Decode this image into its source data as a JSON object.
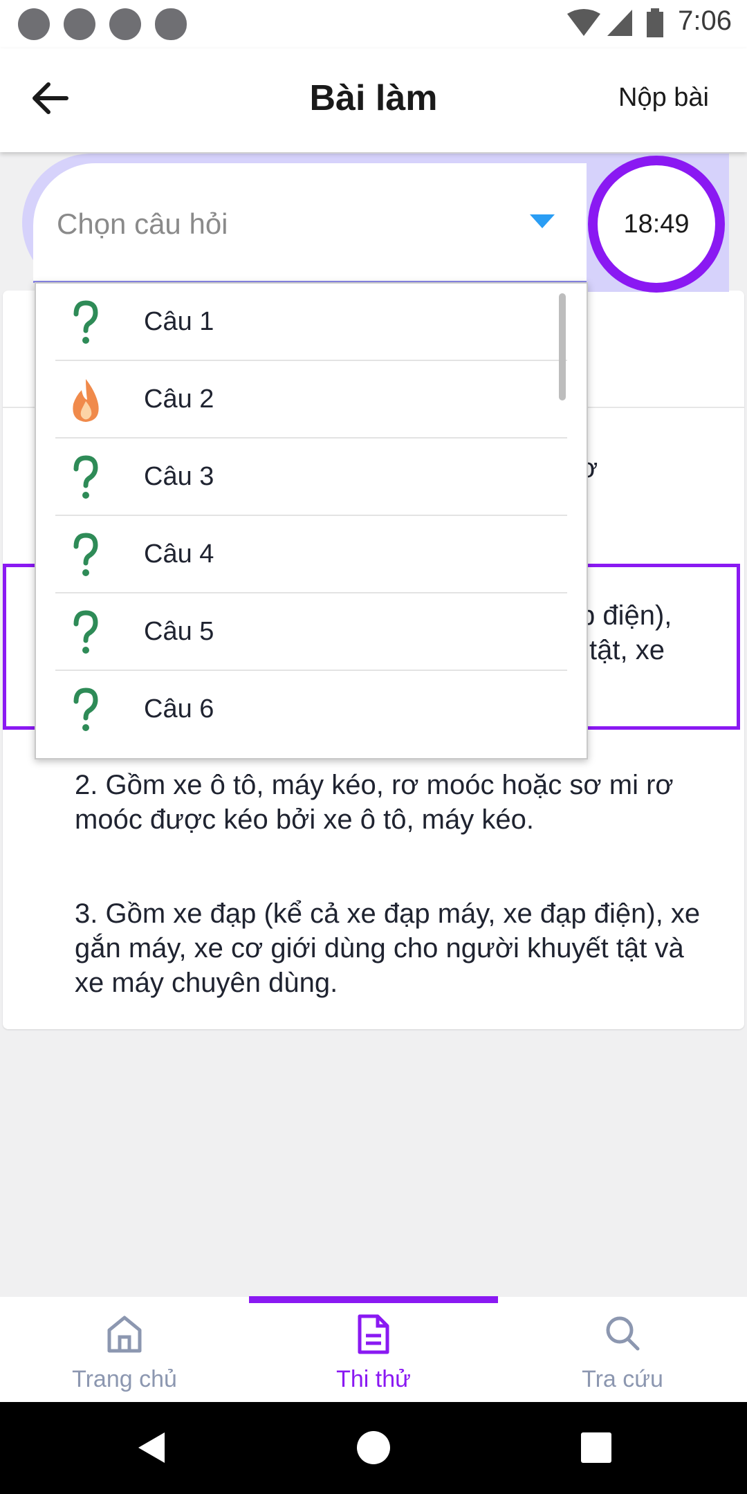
{
  "status_bar": {
    "time": "7:06"
  },
  "app_bar": {
    "title": "Bài làm",
    "submit_label": "Nộp bài"
  },
  "selector": {
    "placeholder": "Chọn câu hỏi",
    "timer": "18:49"
  },
  "dropdown": {
    "items": [
      {
        "label": "Câu 1",
        "icon": "question-icon"
      },
      {
        "label": "Câu 2",
        "icon": "fire-icon"
      },
      {
        "label": "Câu 3",
        "icon": "question-icon"
      },
      {
        "label": "Câu 4",
        "icon": "question-icon"
      },
      {
        "label": "Câu 5",
        "icon": "question-icon"
      },
      {
        "label": "Câu 6",
        "icon": "question-icon"
      }
    ]
  },
  "question": {
    "visible_fragments": [
      "ơ",
      "p điện),",
      "tật, xe"
    ],
    "answers": [
      "2. Gồm xe ô tô, máy kéo, rơ moóc hoặc sơ mi rơ moóc được kéo bởi xe ô tô, máy kéo.",
      "3. Gồm xe đạp (kể cả xe đạp máy, xe đạp điện), xe gắn máy, xe cơ giới dùng cho người khuyết tật và xe máy chuyên dùng."
    ]
  },
  "bottom_nav": {
    "items": [
      {
        "label": "Trang chủ",
        "icon": "home-icon",
        "active": false
      },
      {
        "label": "Thi thử",
        "icon": "document-icon",
        "active": true
      },
      {
        "label": "Tra cứu",
        "icon": "search-icon",
        "active": false
      }
    ]
  },
  "colors": {
    "accent": "#8a19f2",
    "caret": "#2a9df4",
    "nav_inactive": "#8c97b0"
  }
}
